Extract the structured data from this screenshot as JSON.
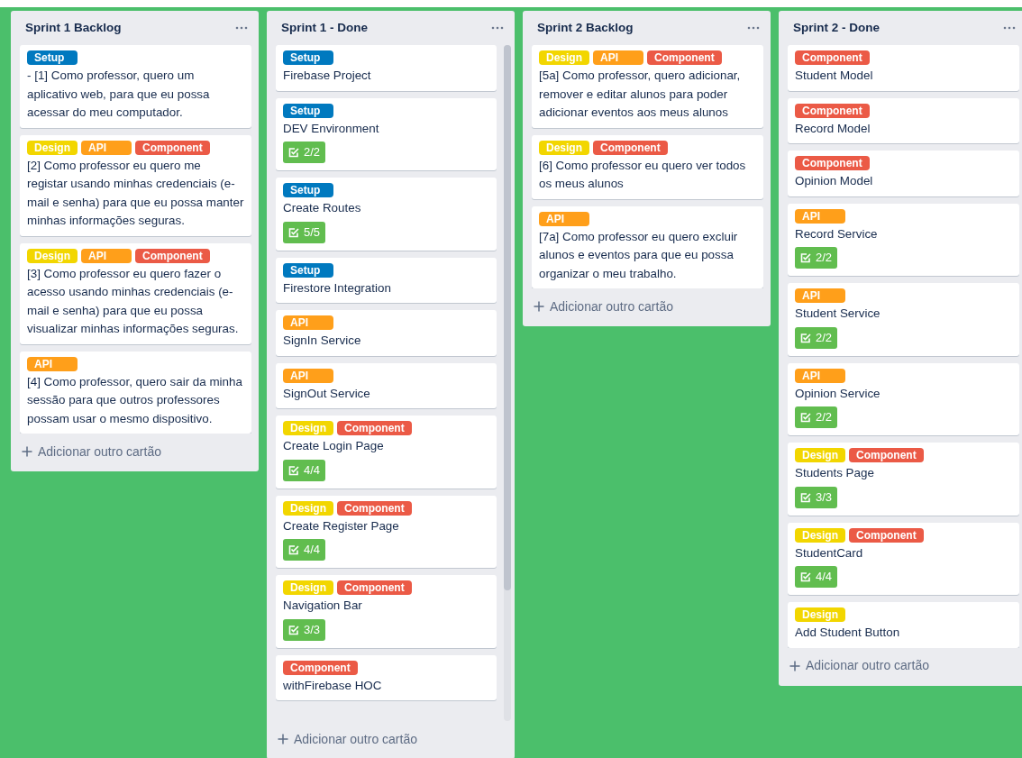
{
  "lists": [
    {
      "title": "Sprint 1 Backlog",
      "scrollbar": false,
      "cards": [
        {
          "labels": [
            {
              "text": "Setup",
              "color": "#0079bf"
            }
          ],
          "text": "- [1] Como professor, quero um aplicativo web, para que eu possa acessar do meu computador."
        },
        {
          "labels": [
            {
              "text": "Design",
              "color": "#f2d600"
            },
            {
              "text": "API",
              "color": "#ff9f1a"
            },
            {
              "text": "Component",
              "color": "#eb5a46"
            }
          ],
          "text": "[2] Como professor eu quero me registar usando minhas credenciais (e-mail e senha) para que eu possa manter minhas informações seguras."
        },
        {
          "labels": [
            {
              "text": "Design",
              "color": "#f2d600"
            },
            {
              "text": "API",
              "color": "#ff9f1a"
            },
            {
              "text": "Component",
              "color": "#eb5a46"
            }
          ],
          "text": "[3] Como professor eu quero fazer o acesso usando minhas credenciais (e-mail e senha) para que eu possa visualizar minhas informações seguras."
        },
        {
          "labels": [
            {
              "text": "API",
              "color": "#ff9f1a"
            }
          ],
          "text": "[4] Como professor, quero sair da minha sessão para que outros professores possam usar o mesmo dispositivo."
        }
      ],
      "add_card": "Adicionar outro cartão"
    },
    {
      "title": "Sprint 1 - Done",
      "scrollbar": true,
      "cards": [
        {
          "labels": [
            {
              "text": "Setup",
              "color": "#0079bf"
            }
          ],
          "text": "Firebase Project"
        },
        {
          "labels": [
            {
              "text": "Setup",
              "color": "#0079bf"
            }
          ],
          "text": "DEV Environment",
          "checklist": "2/2"
        },
        {
          "labels": [
            {
              "text": "Setup",
              "color": "#0079bf"
            }
          ],
          "text": "Create Routes",
          "checklist": "5/5"
        },
        {
          "labels": [
            {
              "text": "Setup",
              "color": "#0079bf"
            }
          ],
          "text": "Firestore Integration"
        },
        {
          "labels": [
            {
              "text": "API",
              "color": "#ff9f1a"
            }
          ],
          "text": "SignIn Service"
        },
        {
          "labels": [
            {
              "text": "API",
              "color": "#ff9f1a"
            }
          ],
          "text": "SignOut Service"
        },
        {
          "labels": [
            {
              "text": "Design",
              "color": "#f2d600"
            },
            {
              "text": "Component",
              "color": "#eb5a46"
            }
          ],
          "text": "Create Login Page",
          "checklist": "4/4"
        },
        {
          "labels": [
            {
              "text": "Design",
              "color": "#f2d600"
            },
            {
              "text": "Component",
              "color": "#eb5a46"
            }
          ],
          "text": "Create Register Page",
          "checklist": "4/4"
        },
        {
          "labels": [
            {
              "text": "Design",
              "color": "#f2d600"
            },
            {
              "text": "Component",
              "color": "#eb5a46"
            }
          ],
          "text": "Navigation Bar",
          "checklist": "3/3"
        },
        {
          "labels": [
            {
              "text": "Component",
              "color": "#eb5a46"
            }
          ],
          "text": "withFirebase HOC"
        }
      ],
      "add_card": "Adicionar outro cartão"
    },
    {
      "title": "Sprint 2 Backlog",
      "scrollbar": false,
      "cards": [
        {
          "labels": [
            {
              "text": "Design",
              "color": "#f2d600"
            },
            {
              "text": "API",
              "color": "#ff9f1a"
            },
            {
              "text": "Component",
              "color": "#eb5a46"
            }
          ],
          "text": "[5a] Como professor, quero adicionar, remover e editar alunos para poder adicionar eventos aos meus alunos"
        },
        {
          "labels": [
            {
              "text": "Design",
              "color": "#f2d600"
            },
            {
              "text": "Component",
              "color": "#eb5a46"
            }
          ],
          "text": "[6] Como professor eu quero ver todos os meus alunos"
        },
        {
          "labels": [
            {
              "text": "API",
              "color": "#ff9f1a"
            }
          ],
          "text": "[7a] Como professor eu quero excluir alunos e eventos para que eu possa organizar o meu trabalho."
        }
      ],
      "add_card": "Adicionar outro cartão"
    },
    {
      "title": "Sprint 2 - Done",
      "scrollbar": false,
      "cards": [
        {
          "labels": [
            {
              "text": "Component",
              "color": "#eb5a46"
            }
          ],
          "text": "Student Model"
        },
        {
          "labels": [
            {
              "text": "Component",
              "color": "#eb5a46"
            }
          ],
          "text": "Record Model"
        },
        {
          "labels": [
            {
              "text": "Component",
              "color": "#eb5a46"
            }
          ],
          "text": "Opinion Model"
        },
        {
          "labels": [
            {
              "text": "API",
              "color": "#ff9f1a"
            }
          ],
          "text": "Record Service",
          "checklist": "2/2"
        },
        {
          "labels": [
            {
              "text": "API",
              "color": "#ff9f1a"
            }
          ],
          "text": "Student Service",
          "checklist": "2/2"
        },
        {
          "labels": [
            {
              "text": "API",
              "color": "#ff9f1a"
            }
          ],
          "text": "Opinion Service",
          "checklist": "2/2"
        },
        {
          "labels": [
            {
              "text": "Design",
              "color": "#f2d600"
            },
            {
              "text": "Component",
              "color": "#eb5a46"
            }
          ],
          "text": "Students Page",
          "checklist": "3/3"
        },
        {
          "labels": [
            {
              "text": "Design",
              "color": "#f2d600"
            },
            {
              "text": "Component",
              "color": "#eb5a46"
            }
          ],
          "text": "StudentCard",
          "checklist": "4/4"
        },
        {
          "labels": [
            {
              "text": "Design",
              "color": "#f2d600"
            }
          ],
          "text": "Add Student Button"
        }
      ],
      "add_card": "Adicionar outro cartão"
    }
  ]
}
